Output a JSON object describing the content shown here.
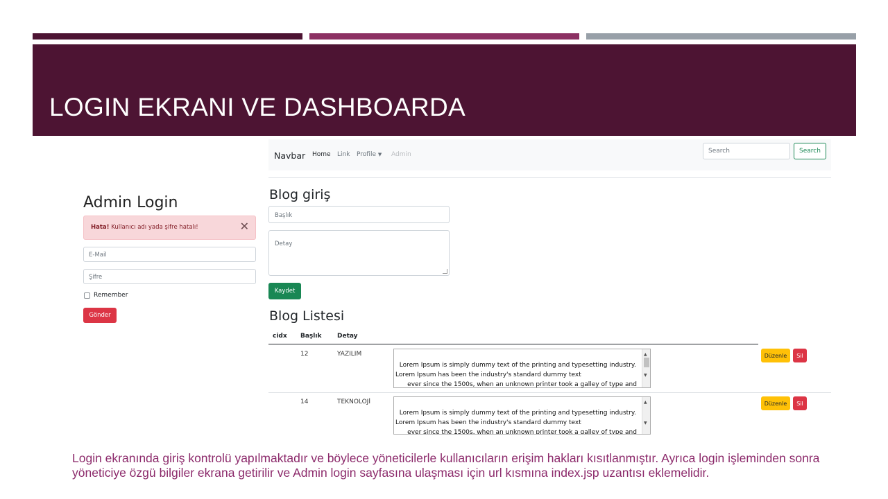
{
  "slide": {
    "title": "LOGIN EKRANI VE DASHBOARDA",
    "caption": "Login ekranında giriş  kontrolü yapılmaktadır ve böylece yöneticilerle kullanıcıların erişim hakları kısıtlanmıştır.  Ayrıca login işleminden sonra yöneticiye özgü bilgiler ekrana getirilir ve Admin login sayfasına ulaşması için url kısmına index.jsp uzantısı eklemelidir.",
    "colors": {
      "band": "#4d1433",
      "accent": "#8c3163",
      "gray": "#98a0a8",
      "caption": "#8c2a6b"
    }
  },
  "login": {
    "title": "Admin Login",
    "alert_strong": "Hata!",
    "alert_text": " Kullanıcı adı yada şifre hatalı!",
    "email_placeholder": "E-Mail",
    "password_placeholder": "Şifre",
    "remember_label": "Remember",
    "submit_label": "Gönder"
  },
  "navbar": {
    "brand": "Navbar",
    "home": "Home",
    "link": "Link",
    "profile": "Profile",
    "admin": "Admin",
    "search_placeholder": "Search",
    "search_button": "Search"
  },
  "blog_form": {
    "title": "Blog giriş",
    "title_placeholder": "Başlık",
    "detail_placeholder": "Detay",
    "save_label": "Kaydet"
  },
  "blog_list": {
    "title": "Blog Listesi",
    "headers": [
      "cidx",
      "Başlık",
      "Detay"
    ],
    "edit_label": "Düzenle",
    "delete_label": "Sil",
    "rows": [
      {
        "cidx": "",
        "id": "12",
        "title": "YAZILIM",
        "detail": "Lorem Ipsum is simply dummy text of the printing and typesetting industry.\nLorem Ipsum has been the industry's standard dummy text\n      ever since the 1500s, when an unknown printer took a galley of type and\nscrambled it to make a type specimen book. It has survived not only"
      },
      {
        "cidx": "",
        "id": "14",
        "title": "TEKNOLOJİ",
        "detail": "Lorem Ipsum is simply dummy text of the printing and typesetting industry.\nLorem Ipsum has been the industry's standard dummy text\n      ever since the 1500s, when an unknown printer took a galley of type and\nscrambled it to make a type specimen book. It has survived not only"
      }
    ]
  }
}
